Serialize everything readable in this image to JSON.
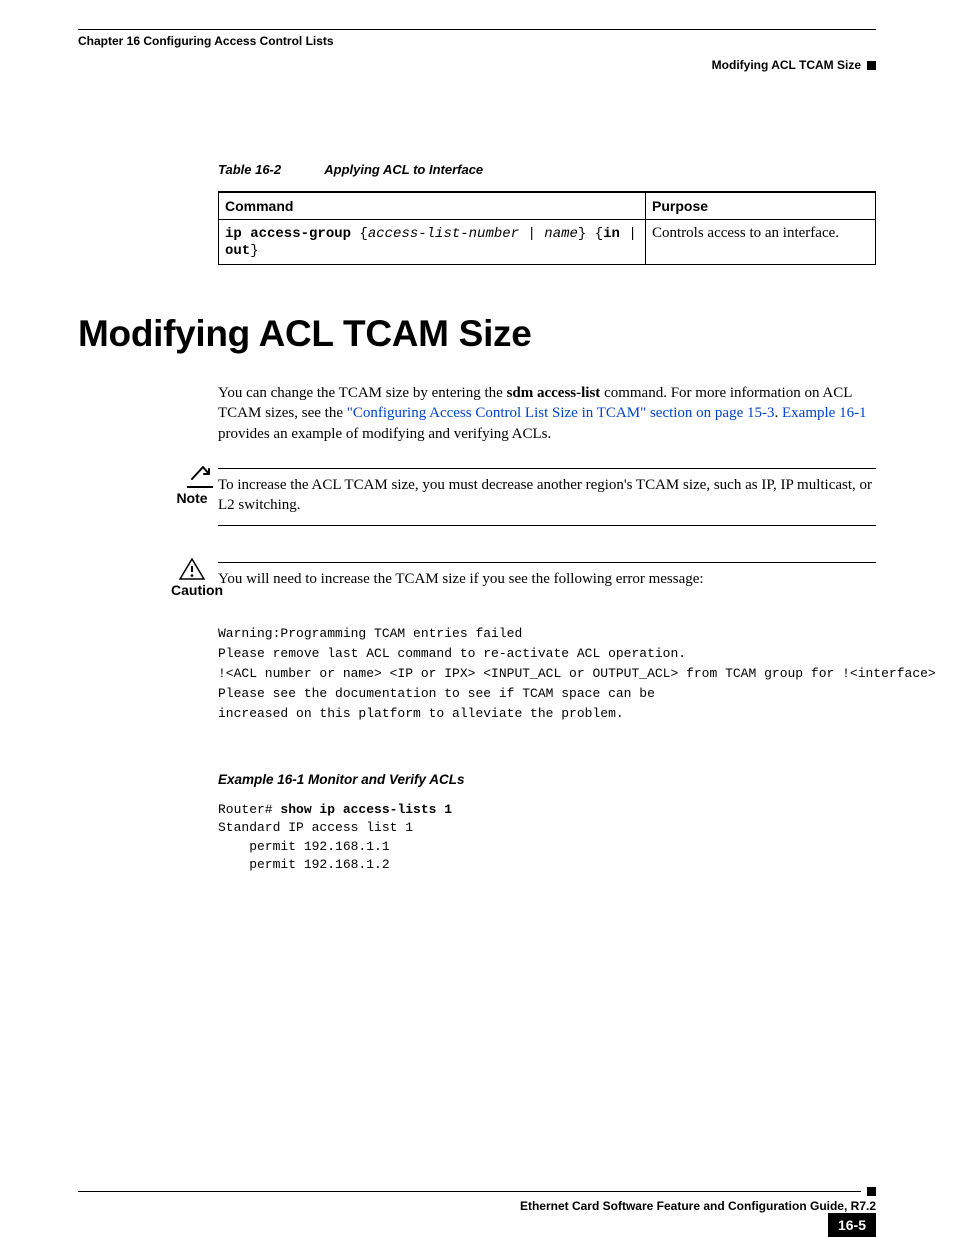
{
  "header": {
    "chapter": "Chapter 16 Configuring Access Control Lists",
    "section": "Modifying ACL TCAM Size"
  },
  "table": {
    "label": "Table 16-2",
    "title": "Applying ACL to Interface",
    "headers": {
      "command": "Command",
      "purpose": "Purpose"
    },
    "row": {
      "cmd_kw": "ip access-group",
      "cmd_open": " {",
      "cmd_arg1": "access-list-number",
      "cmd_sep1": " | ",
      "cmd_arg2": "name",
      "cmd_close1": "} {",
      "cmd_in": "in",
      "cmd_sep2": " | ",
      "cmd_out": "out",
      "cmd_close2": "}",
      "purpose": "Controls access to an interface."
    }
  },
  "h1": "Modifying ACL TCAM Size",
  "body": {
    "p1a": "You can change the TCAM size by entering the ",
    "p1bold": "sdm access-list",
    "p1b": " command. For more information on ACL TCAM sizes, see the ",
    "p1link1": "\"Configuring Access Control List Size in TCAM\" section on page 15-3",
    "p1c": ". ",
    "p1link2": "Example 16-1",
    "p1d": " provides an example of modifying and verifying ACLs."
  },
  "note": {
    "label": "Note",
    "text": "To increase the ACL TCAM size, you must decrease another region's TCAM size, such as IP, IP multicast, or L2 switching."
  },
  "caution": {
    "label": "Caution",
    "text": "You will need to increase the TCAM size if you see the following error message:"
  },
  "warning_code": "Warning:Programming TCAM entries failed\nPlease remove last ACL command to re-activate ACL operation.\n!<ACL number or name> <IP or IPX> <INPUT_ACL or OUTPUT_ACL> from TCAM group for !<interface>\nPlease see the documentation to see if TCAM space can be\nincreased on this platform to alleviate the problem.",
  "example": {
    "caption": "Example 16-1  Monitor and Verify ACLs",
    "prompt": "Router# ",
    "cmd": "show ip access-lists 1",
    "output": "Standard IP access list 1\n    permit 192.168.1.1\n    permit 192.168.1.2"
  },
  "footer": {
    "title": "Ethernet Card Software Feature and Configuration Guide, R7.2",
    "page": "16-5"
  }
}
